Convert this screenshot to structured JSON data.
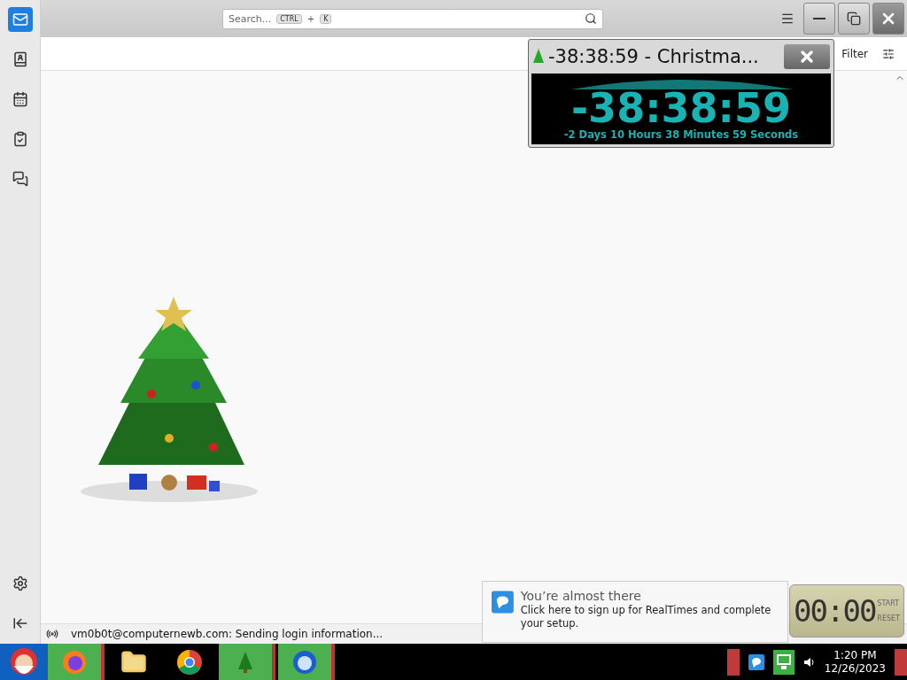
{
  "sidebar": {
    "items": [
      {
        "kind": "mail",
        "selected": true
      },
      {
        "kind": "contacts",
        "selected": false
      },
      {
        "kind": "calendar",
        "selected": false
      },
      {
        "kind": "tasks",
        "selected": false
      },
      {
        "kind": "chat",
        "selected": false
      }
    ],
    "bottom": [
      {
        "kind": "settings"
      },
      {
        "kind": "collapse"
      }
    ]
  },
  "search": {
    "placeholder": "Search...",
    "keys": [
      "CTRL",
      "K"
    ],
    "joiner": "+"
  },
  "toolbar": {
    "filter": "Filter"
  },
  "countdown": {
    "title": "-38:38:59 - Christma...",
    "time": "-38:38:59",
    "detail": "-2 Days 10 Hours 38 Minutes 59 Seconds"
  },
  "status": {
    "text": "vm0b0t@computernewb.com: Sending login information..."
  },
  "notification": {
    "title": "You’re almost there",
    "body": "Click here to sign up for RealTimes and complete your setup."
  },
  "stopwatch": {
    "time": "00:00",
    "buttons": [
      "START",
      "RESET"
    ]
  },
  "taskbar": {
    "apps": [
      {
        "kind": "firefox",
        "highlighted": true
      },
      {
        "kind": "folder",
        "highlighted": false
      },
      {
        "kind": "chrome",
        "highlighted": false
      },
      {
        "kind": "tree",
        "highlighted": true
      },
      {
        "kind": "thunderbird",
        "highlighted": true
      }
    ]
  },
  "clock": {
    "time": "1:20 PM",
    "date": "12/26/2023"
  }
}
